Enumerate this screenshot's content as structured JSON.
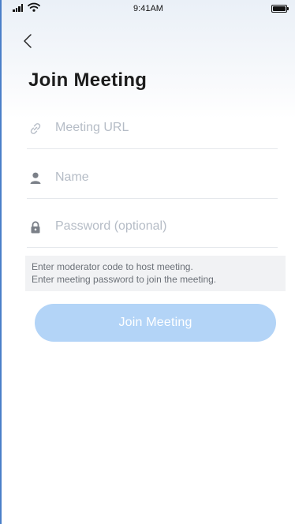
{
  "status_bar": {
    "time": "9:41AM"
  },
  "header": {
    "title": "Join Meeting"
  },
  "form": {
    "meeting_url_placeholder": "Meeting URL",
    "name_placeholder": "Name",
    "password_placeholder": "Password (optional)"
  },
  "hint": {
    "line1": "Enter moderator code to host meeting.",
    "line2": "Enter meeting password to join the meeting."
  },
  "actions": {
    "join_label": "Join Meeting"
  },
  "colors": {
    "button_disabled": "#b3d4f7",
    "placeholder": "#b5bcc6",
    "hint_bg": "#f1f2f4"
  },
  "icons": {
    "link": "link-icon",
    "user": "user-icon",
    "lock": "lock-icon",
    "back": "chevron-left-icon"
  }
}
